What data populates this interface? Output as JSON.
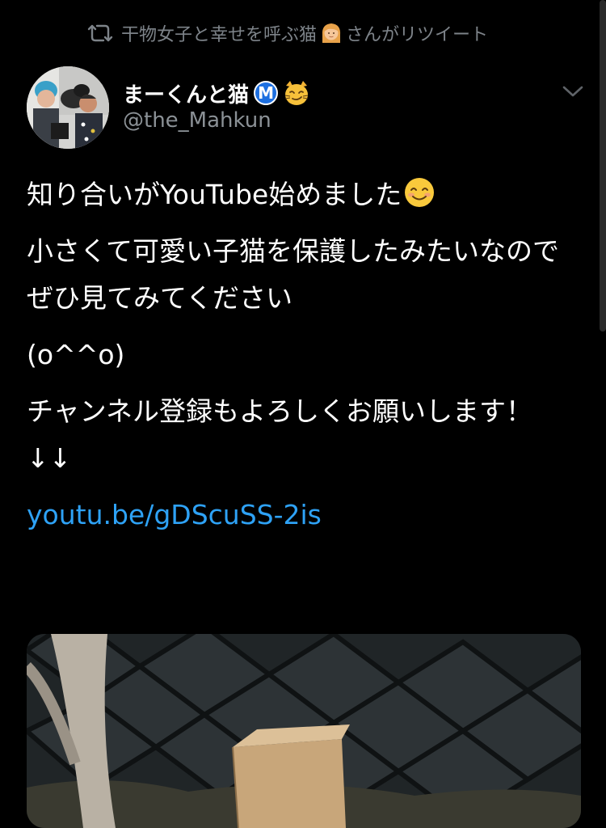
{
  "retweet": {
    "icon": "retweet-icon",
    "text_before": "干物女子と幸せを呼ぶ猫",
    "emoji": "woman-blond-emoji",
    "text_after": "さんがリツイート"
  },
  "author": {
    "display_name": "まーくんと猫",
    "badge": "M",
    "badge_color": "#1d6fe0",
    "name_emoji": "smirking-cat-emoji",
    "handle": "@the_Mahkun"
  },
  "tweet": {
    "line1": "知り合いがYouTube始めました",
    "line1_emoji": "smiling-face-emoji",
    "para2": "小さくて可愛い子猫を保護したみたいなのでぜひ見てみてください",
    "para3": "(o^^o)",
    "para4": "チャンネル登録もよろしくお願いします！",
    "arrows": "↓↓",
    "link": "youtu.be/gDScuSS-2is"
  },
  "media": {
    "icon": "photo-thumbnail"
  },
  "colors": {
    "background": "#000000",
    "text": "#ffffff",
    "secondary": "#8b9196",
    "link": "#2ea2f6"
  }
}
